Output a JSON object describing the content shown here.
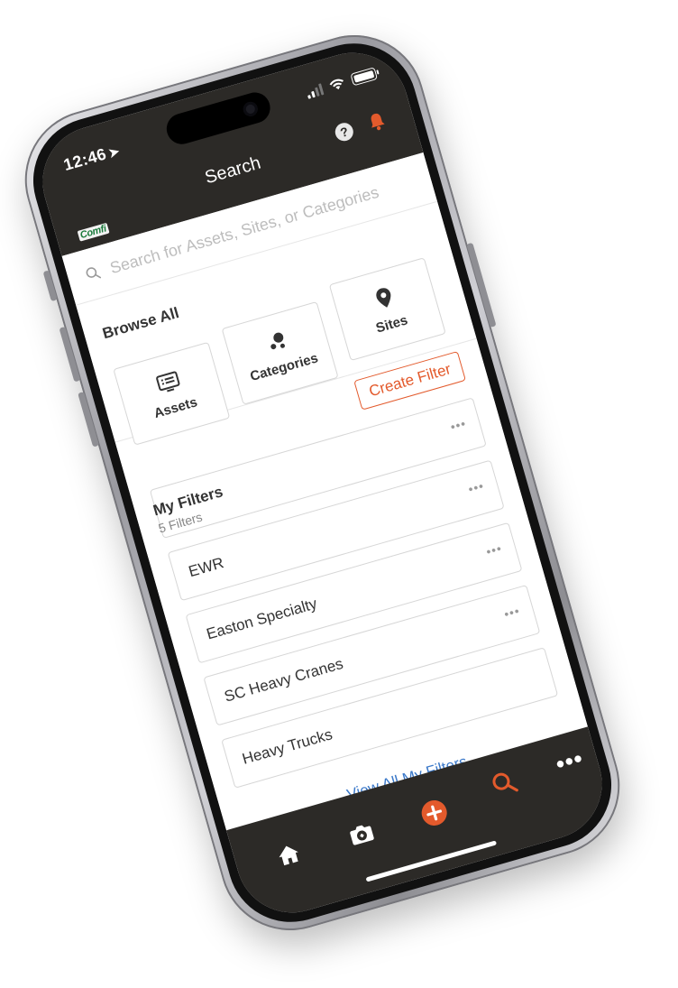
{
  "status_bar": {
    "time": "12:46"
  },
  "header": {
    "title": "Search",
    "logo_text": "Comfi"
  },
  "search": {
    "placeholder": "Search for Assets, Sites, or Categories",
    "value": ""
  },
  "browse": {
    "title": "Browse All",
    "tiles": [
      {
        "label": "Assets",
        "icon": "list-screen-icon"
      },
      {
        "label": "Categories",
        "icon": "dots-cluster-icon"
      },
      {
        "label": "Sites",
        "icon": "map-pin-icon"
      }
    ]
  },
  "create_filter_label": "Create Filter",
  "my_filters": {
    "title": "My Filters",
    "count_text": "5 Filters",
    "items": [
      {
        "name": "EWR"
      },
      {
        "name": "Easton Specialty"
      },
      {
        "name": "SC Heavy Cranes"
      },
      {
        "name": "Heavy Trucks"
      }
    ],
    "view_all_label": "View All My Filters"
  },
  "tabbar": {
    "tabs": [
      "home-icon",
      "camera-icon",
      "add-icon",
      "search-icon",
      "more-icon"
    ],
    "active": "search-icon"
  },
  "colors": {
    "accent": "#e35a2c",
    "link": "#3a78c9",
    "header_bg": "#2c2a27",
    "brand_logo": "#1a7a3b"
  }
}
